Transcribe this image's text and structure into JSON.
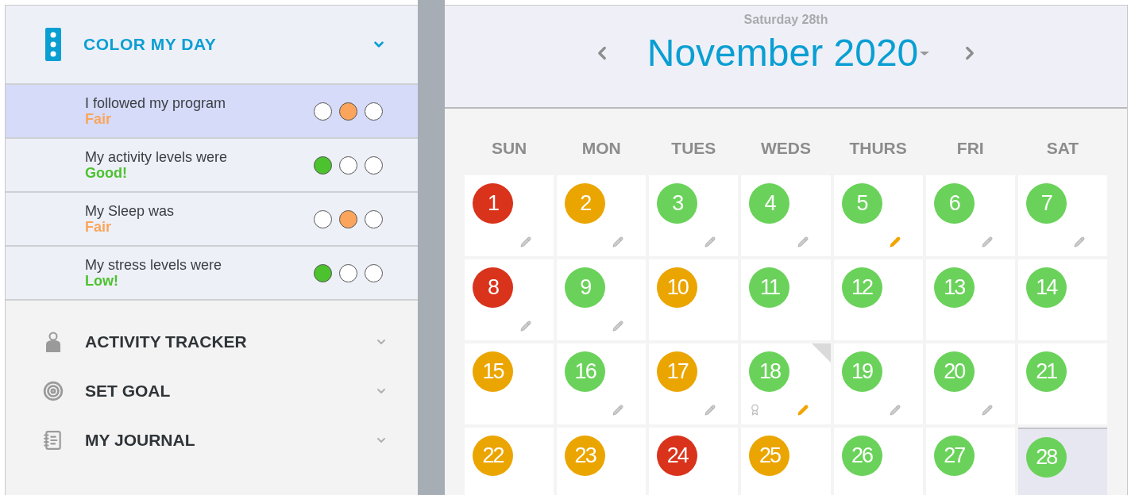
{
  "sidebar": {
    "header": {
      "title": "COLOR MY DAY",
      "expanded": true
    },
    "ratings": [
      {
        "label": "I followed my program",
        "value": "Fair",
        "color": "#fba55c",
        "selected": true,
        "choices": [
          {
            "selected": false
          },
          {
            "selected": true
          },
          {
            "selected": false
          }
        ]
      },
      {
        "label": "My activity levels were",
        "value": "Good!",
        "color": "#4cc22e",
        "selected": false,
        "choices": [
          {
            "selected": true
          },
          {
            "selected": false
          },
          {
            "selected": false
          }
        ]
      },
      {
        "label": "My Sleep was",
        "value": "Fair",
        "color": "#fba55c",
        "selected": false,
        "choices": [
          {
            "selected": false
          },
          {
            "selected": true
          },
          {
            "selected": false
          }
        ]
      },
      {
        "label": "My stress levels were",
        "value": "Low!",
        "color": "#4cc22e",
        "selected": false,
        "choices": [
          {
            "selected": true
          },
          {
            "selected": false
          },
          {
            "selected": false
          }
        ]
      }
    ],
    "items": [
      {
        "label": "ACTIVITY TRACKER",
        "kind": "person"
      },
      {
        "label": "SET GOAL",
        "kind": "target"
      },
      {
        "label": "MY JOURNAL",
        "kind": "journal"
      }
    ]
  },
  "calendar": {
    "subtitle": "Saturday 28th",
    "title": "November 2020",
    "weekdays": [
      "SUN",
      "MON",
      "TUES",
      "WEDS",
      "THURS",
      "FRI",
      "SAT"
    ],
    "days": [
      {
        "day": "1",
        "color": "#d9331c",
        "pencil": true,
        "pencil_active": false,
        "award": false,
        "corner": false,
        "selected": false
      },
      {
        "day": "2",
        "color": "#eba500",
        "pencil": true,
        "pencil_active": false,
        "award": false,
        "corner": false,
        "selected": false
      },
      {
        "day": "3",
        "color": "#6ad25a",
        "pencil": true,
        "pencil_active": false,
        "award": false,
        "corner": false,
        "selected": false
      },
      {
        "day": "4",
        "color": "#6ad25a",
        "pencil": true,
        "pencil_active": false,
        "award": false,
        "corner": false,
        "selected": false
      },
      {
        "day": "5",
        "color": "#6ad25a",
        "pencil": true,
        "pencil_active": true,
        "award": false,
        "corner": false,
        "selected": false
      },
      {
        "day": "6",
        "color": "#6ad25a",
        "pencil": true,
        "pencil_active": false,
        "award": false,
        "corner": false,
        "selected": false
      },
      {
        "day": "7",
        "color": "#6ad25a",
        "pencil": true,
        "pencil_active": false,
        "award": false,
        "corner": false,
        "selected": false
      },
      {
        "day": "8",
        "color": "#d9331c",
        "pencil": true,
        "pencil_active": false,
        "award": false,
        "corner": false,
        "selected": false
      },
      {
        "day": "9",
        "color": "#6ad25a",
        "pencil": true,
        "pencil_active": false,
        "award": false,
        "corner": false,
        "selected": false
      },
      {
        "day": "10",
        "color": "#eba500",
        "pencil": false,
        "award": false,
        "corner": false,
        "selected": false
      },
      {
        "day": "11",
        "color": "#6ad25a",
        "pencil": false,
        "award": false,
        "corner": false,
        "selected": false
      },
      {
        "day": "12",
        "color": "#6ad25a",
        "pencil": false,
        "award": false,
        "corner": false,
        "selected": false
      },
      {
        "day": "13",
        "color": "#6ad25a",
        "pencil": false,
        "award": false,
        "corner": false,
        "selected": false
      },
      {
        "day": "14",
        "color": "#6ad25a",
        "pencil": false,
        "award": false,
        "corner": false,
        "selected": false
      },
      {
        "day": "15",
        "color": "#eba500",
        "pencil": false,
        "award": false,
        "corner": false,
        "selected": false
      },
      {
        "day": "16",
        "color": "#6ad25a",
        "pencil": true,
        "pencil_active": false,
        "award": false,
        "corner": false,
        "selected": false
      },
      {
        "day": "17",
        "color": "#eba500",
        "pencil": true,
        "pencil_active": false,
        "award": false,
        "corner": false,
        "selected": false
      },
      {
        "day": "18",
        "color": "#6ad25a",
        "pencil": true,
        "pencil_active": true,
        "award": true,
        "corner": true,
        "selected": false
      },
      {
        "day": "19",
        "color": "#6ad25a",
        "pencil": true,
        "pencil_active": false,
        "award": false,
        "corner": false,
        "selected": false
      },
      {
        "day": "20",
        "color": "#6ad25a",
        "pencil": true,
        "pencil_active": false,
        "award": false,
        "corner": false,
        "selected": false
      },
      {
        "day": "21",
        "color": "#6ad25a",
        "pencil": false,
        "award": false,
        "corner": false,
        "selected": false
      },
      {
        "day": "22",
        "color": "#eba500",
        "pencil": false,
        "award": false,
        "corner": false,
        "selected": false
      },
      {
        "day": "23",
        "color": "#eba500",
        "pencil": false,
        "award": false,
        "corner": false,
        "selected": false
      },
      {
        "day": "24",
        "color": "#d9331c",
        "pencil": false,
        "award": false,
        "corner": false,
        "selected": false
      },
      {
        "day": "25",
        "color": "#eba500",
        "pencil": false,
        "award": false,
        "corner": false,
        "selected": false
      },
      {
        "day": "26",
        "color": "#6ad25a",
        "pencil": false,
        "award": false,
        "corner": false,
        "selected": false
      },
      {
        "day": "27",
        "color": "#6ad25a",
        "pencil": false,
        "award": false,
        "corner": false,
        "selected": false
      },
      {
        "day": "28",
        "color": "#6ad25a",
        "pencil": false,
        "award": false,
        "corner": false,
        "selected": true
      }
    ]
  }
}
